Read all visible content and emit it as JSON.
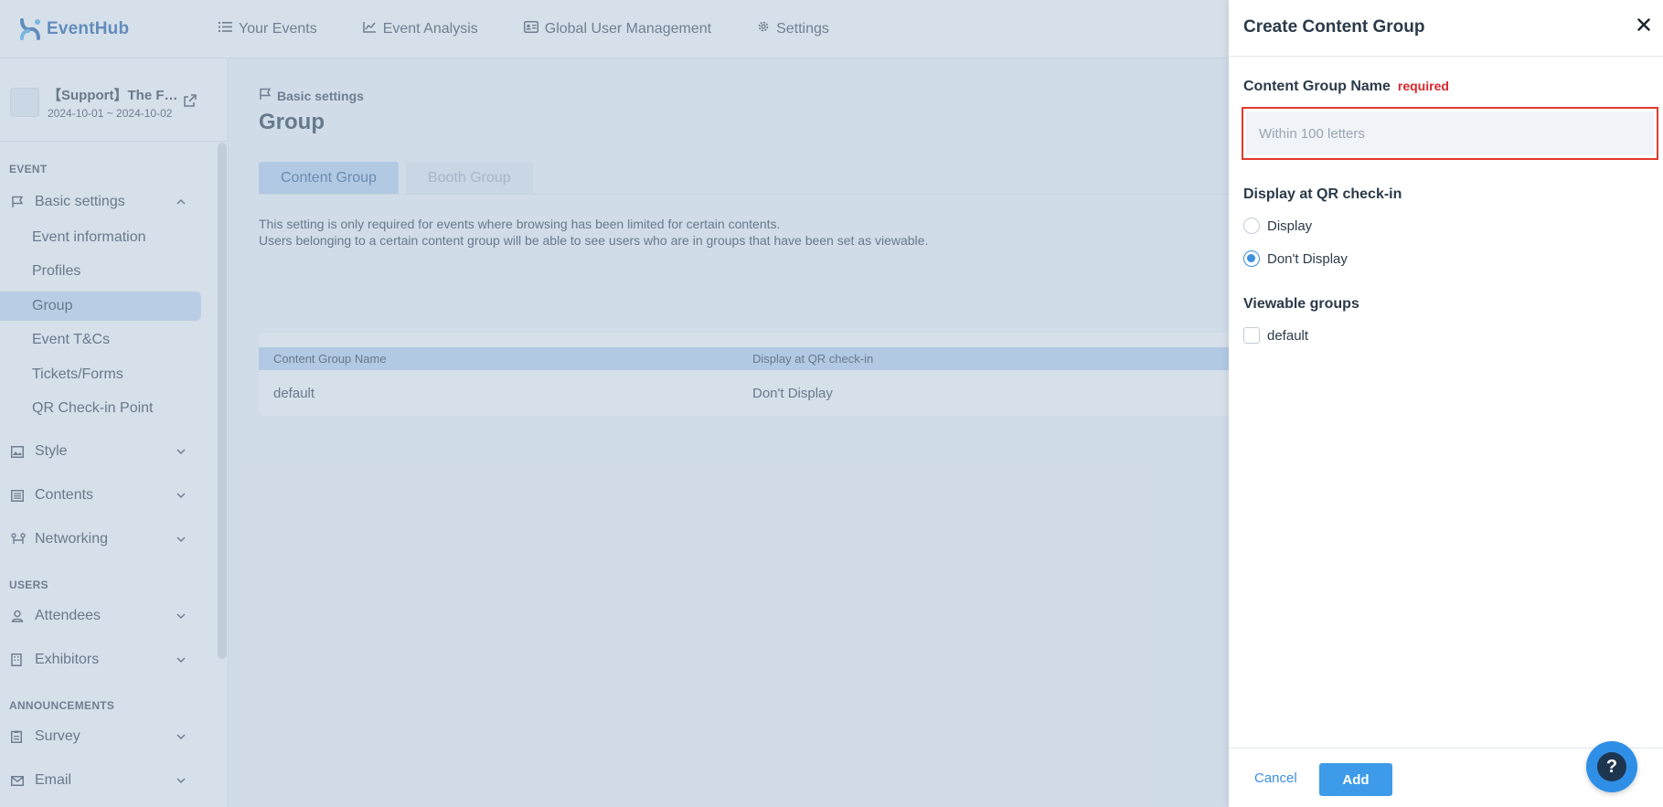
{
  "app": {
    "name": "EventHub",
    "brand_color": "#1f5fa8"
  },
  "nav": [
    {
      "label": "Your Events",
      "icon": "list-icon"
    },
    {
      "label": "Event Analysis",
      "icon": "chart-line-icon"
    },
    {
      "label": "Global User Management",
      "icon": "id-card-icon"
    },
    {
      "label": "Settings",
      "icon": "gear-icon"
    }
  ],
  "event": {
    "title": "【Support】The F…",
    "dates": "2024-10-01 ~ 2024-10-02"
  },
  "sidebar": {
    "section_event": "EVENT",
    "basic_settings": "Basic settings",
    "sub_items": [
      "Event information",
      "Profiles",
      "Group",
      "Event T&Cs",
      "Tickets/Forms",
      "QR Check-in Point"
    ],
    "active_sub": "Group",
    "style": "Style",
    "contents": "Contents",
    "networking": "Networking",
    "section_users": "USERS",
    "attendees": "Attendees",
    "exhibitors": "Exhibitors",
    "section_announcements": "ANNOUNCEMENTS",
    "survey": "Survey",
    "email": "Email"
  },
  "main": {
    "breadcrumb": "Basic settings",
    "title": "Group",
    "tabs": [
      "Content Group",
      "Booth Group"
    ],
    "active_tab": "Content Group",
    "desc_line1": "This setting is only required for events where browsing has been limited for certain contents.",
    "desc_line2": "Users belonging to a certain content group will be able to see users who are in groups that have been set as viewable.",
    "table": {
      "headers": [
        "Content Group Name",
        "Display at QR check-in"
      ],
      "rows": [
        [
          "default",
          "Don't Display"
        ]
      ]
    }
  },
  "drawer": {
    "title": "Create Content Group",
    "name_label": "Content Group Name",
    "required_label": "required",
    "name_placeholder": "Within 100 letters",
    "name_value": "",
    "display_label": "Display at QR check-in",
    "display_options": [
      "Display",
      "Don't Display"
    ],
    "display_selected": "Don't Display",
    "viewable_label": "Viewable groups",
    "viewable_options": [
      "default"
    ],
    "cancel_label": "Cancel",
    "add_label": "Add",
    "highlight_color": "#e23a2c",
    "accent_color": "#3d9be9"
  },
  "help": {
    "label": "?"
  }
}
